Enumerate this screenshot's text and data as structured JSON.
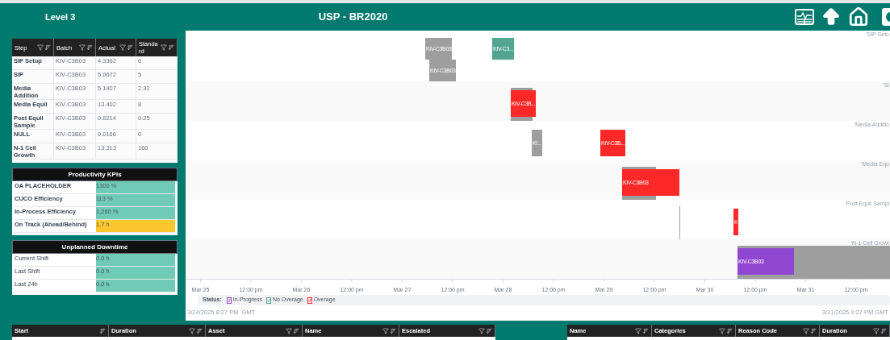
{
  "header": {
    "level": "Level 3",
    "title": "USP - BR2020"
  },
  "steps_table": {
    "columns": [
      "Step",
      "Batch",
      "Actual",
      "Standard"
    ],
    "rows": [
      {
        "step": "SIP Setup",
        "batch": "KIV-C3B03",
        "actual": "4.3362",
        "standard": "6"
      },
      {
        "step": "SIP",
        "batch": "KIV-C3B03",
        "actual": "5.0672",
        "standard": "5"
      },
      {
        "step": "Media Addition",
        "batch": "KIV-C3B03",
        "actual": "5.1407",
        "standard": "2.32"
      },
      {
        "step": "Media Equil",
        "batch": "KIV-C3B03",
        "actual": "13.402",
        "standard": "8"
      },
      {
        "step": "Post Equil Sample",
        "batch": "KIV-C3B03",
        "actual": "0.8214",
        "standard": "0.25"
      },
      {
        "step": "NULL",
        "batch": "KIV-C3B03",
        "actual": "0.0166",
        "standard": "0"
      },
      {
        "step": "N-1 Cell Growth",
        "batch": "KIV-C3B03",
        "actual": "13.313",
        "standard": "160"
      }
    ]
  },
  "kpis": {
    "title": "Productivity KPIs",
    "rows": [
      {
        "label": "OA PLACEHOLDER",
        "value": "1300 %",
        "color": "#6fcbb5"
      },
      {
        "label": "CUCO Efficiency",
        "value": "113 %",
        "color": "#6fcbb5"
      },
      {
        "label": "In-Process Efficiency",
        "value": "1,260 %",
        "color": "#6fcbb5"
      },
      {
        "label": "On Track (Ahead/Behind)",
        "value": "1.7 h",
        "color": "#fcc72c"
      }
    ]
  },
  "downtime": {
    "title": "Unplanned Downtime",
    "rows": [
      {
        "label": "Current Shift",
        "value": "0.0 h",
        "color": "#6fcbb5"
      },
      {
        "label": "Last Shift",
        "value": "0.0 h",
        "color": "#6fcbb5"
      },
      {
        "label": "Last 24h",
        "value": "0.0 h",
        "color": "#6fcbb5"
      }
    ]
  },
  "gantt": {
    "lanes": [
      {
        "label": "'SIP Setu",
        "bars": [
          {
            "kind": "other",
            "label": "KIV-C3B03"
          },
          {
            "kind": "other",
            "label": "KIV-C3B03"
          },
          {
            "kind": "no-overage",
            "label": "KIV-C3..."
          }
        ]
      },
      {
        "label": "'SI",
        "bars": [
          {
            "kind": "standard"
          },
          {
            "kind": "overage",
            "label": "KIV-C3B..."
          }
        ]
      },
      {
        "label": "'Media Additio",
        "bars": [
          {
            "kind": "other",
            "label": "KI..."
          },
          {
            "kind": "overage",
            "label": "KIV-C3B..."
          }
        ]
      },
      {
        "label": "'Media Equ",
        "bars": [
          {
            "kind": "standard"
          },
          {
            "kind": "overage",
            "label": "KIV-C3B03"
          }
        ]
      },
      {
        "label": "'Post Equil Sampl",
        "bars": [
          {
            "kind": "standard"
          },
          {
            "kind": "overage",
            "label": "K"
          }
        ]
      },
      {
        "label": "'N-1 Cell Growt",
        "bars": [
          {
            "kind": "standard"
          },
          {
            "kind": "in-progress",
            "label": "KIV-C3B03"
          }
        ]
      }
    ],
    "ticks": [
      "Mar 25",
      "12:00 pm",
      "Mar 26",
      "12:00 pm",
      "Mar 27",
      "12:00 pm",
      "Mar 28",
      "12:00 pm",
      "Mar 29",
      "12:00 pm",
      "Mar 30",
      "12:00 pm",
      "Mar 31",
      "12:00 pm"
    ],
    "legend": {
      "title": "Status:",
      "items": [
        {
          "kind": "in-progress",
          "label": "In-Progress",
          "color": "#9146d1"
        },
        {
          "kind": "no-overage",
          "label": "No Overage",
          "color": "#52a58f"
        },
        {
          "kind": "overage",
          "label": "Overage",
          "color": "#ff2828"
        }
      ]
    },
    "range_start_label": "3/24/2025 8:27 PM  GMT",
    "range_end_label": "3/31/2025 9:27 PM GMT"
  },
  "events_table": {
    "columns": [
      {
        "label": "Start",
        "filter": false
      },
      {
        "label": "Duration",
        "filter": true
      },
      {
        "label": "Asset",
        "filter": true
      },
      {
        "label": "Name",
        "filter": true
      },
      {
        "label": "Escalated",
        "filter": true
      }
    ]
  },
  "downtime_table": {
    "columns": [
      {
        "label": "Name",
        "filter": true
      },
      {
        "label": "Categories",
        "filter": true
      },
      {
        "label": "Reason Code",
        "filter": true
      },
      {
        "label": "Duration",
        "filter": true
      }
    ]
  }
}
